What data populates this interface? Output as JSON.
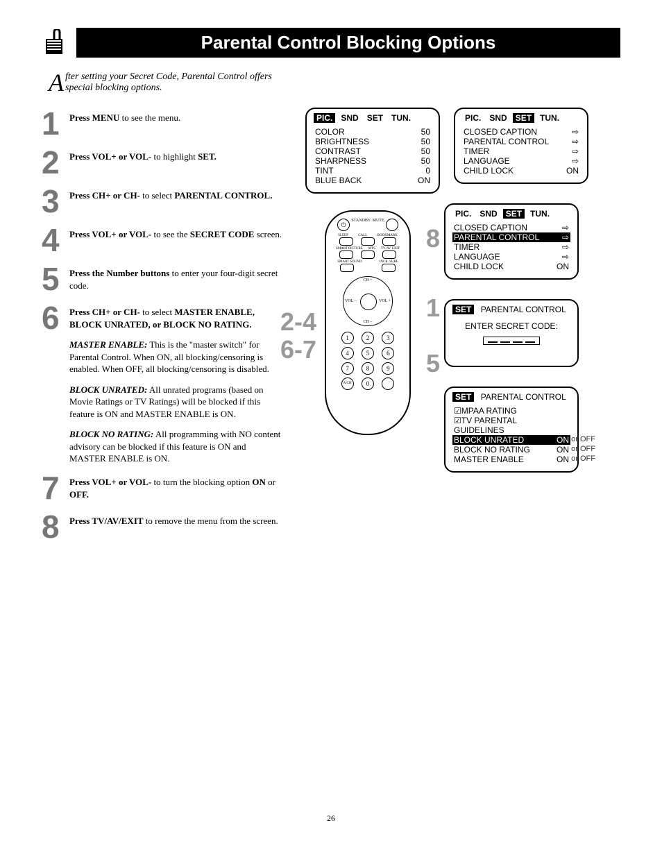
{
  "title": "Parental Control Blocking Options",
  "intro_first_letter": "A",
  "intro_rest": "fter setting your Secret Code, Parental Control offers special blocking options.",
  "steps": [
    {
      "n": "1",
      "html": "<b>Press MENU</b> to see the menu."
    },
    {
      "n": "2",
      "html": "<b>Press VOL+ or VOL-</b> to highlight <b>SET.</b>"
    },
    {
      "n": "3",
      "html": "<b>Press CH+ or CH-</b> to select <b>PARENTAL CONTROL.</b>"
    },
    {
      "n": "4",
      "html": "<b>Press VOL+ or VOL-</b> to see the <b>SECRET CODE</b> screen."
    },
    {
      "n": "5",
      "html": "<b>Press the Number buttons</b> to enter your four-digit secret code."
    },
    {
      "n": "6",
      "html": "<b>Press CH+ or CH-</b> to select <b>MASTER ENABLE, BLOCK UNRATED, or BLOCK NO RATING.</b>"
    },
    {
      "n": "7",
      "html": "<b>Press VOL+ or VOL-</b> to turn the blocking option <b>ON</b> or <b>OFF.</b>"
    },
    {
      "n": "8",
      "html": "<b>Press TV/AV/EXIT</b> to remove the menu from the screen."
    }
  ],
  "notes": {
    "me_label": "MASTER ENABLE:",
    "me_text": " This is the \"master switch\" for Parental Control. When ON, all blocking/censoring is enabled. When OFF, all blocking/censoring is disabled.",
    "bu_label": "BLOCK UNRATED:",
    "bu_text": " All unrated programs (based on Movie Ratings or TV Ratings) will be blocked if this feature is ON and MASTER ENABLE is ON.",
    "bnr_label": "BLOCK NO RATING:",
    "bnr_text": " All programming with NO content advisory can be blocked if this feature is ON and MASTER ENABLE is ON."
  },
  "tabs": [
    "PIC.",
    "SND",
    "SET",
    "TUN."
  ],
  "pic_menu": [
    [
      "COLOR",
      "50"
    ],
    [
      "BRIGHTNESS",
      "50"
    ],
    [
      "CONTRAST",
      "50"
    ],
    [
      "SHARPNESS",
      "50"
    ],
    [
      "TINT",
      "0"
    ],
    [
      "BLUE BACK",
      "ON"
    ]
  ],
  "set_menu": [
    [
      "CLOSED CAPTION",
      "⇨"
    ],
    [
      "PARENTAL CONTROL",
      "⇨"
    ],
    [
      "TIMER",
      "⇨"
    ],
    [
      "LANGUAGE",
      "⇨"
    ],
    [
      "CHILD LOCK",
      "ON"
    ]
  ],
  "secret_title": "PARENTAL CONTROL",
  "secret_label": "ENTER SECRET CODE:",
  "pc_menu": {
    "title": "PARENTAL CONTROL",
    "items": [
      "MPAA RATING",
      "TV PARENTAL GUIDELINES",
      "BLOCK UNRATED",
      "BLOCK NO RATING",
      "MASTER ENABLE"
    ],
    "vals": [
      "",
      "",
      "ON",
      "ON",
      "ON"
    ],
    "oroff": "or OFF"
  },
  "callouts": {
    "a": "8",
    "b": "1",
    "c": "2-4",
    "d": "6-7",
    "e": "5"
  },
  "remote_labels": {
    "standby": "STANDBY",
    "mute": "MUTE",
    "sleep": "SLEEP",
    "call": "CALL",
    "bookmark": "BOOKMARK",
    "smart_picture": "SMART PICTURE",
    "mts": "MTS",
    "tvav_exit": "TV/AV EXIT",
    "smart_sound": "SMART SOUND",
    "incr_surf": "INCR. SURF",
    "ch_up": "CH +",
    "ch_dn": "CH –",
    "vol_dn": "VOL –",
    "vol_up": "VOL +",
    "d1": "1",
    "d2": "2",
    "d3": "3",
    "d4": "4",
    "d5": "5",
    "d6": "6",
    "d7": "7",
    "d8": "8",
    "d9": "9",
    "d0": "0",
    "a100": "A/CH"
  },
  "page_number": "26"
}
